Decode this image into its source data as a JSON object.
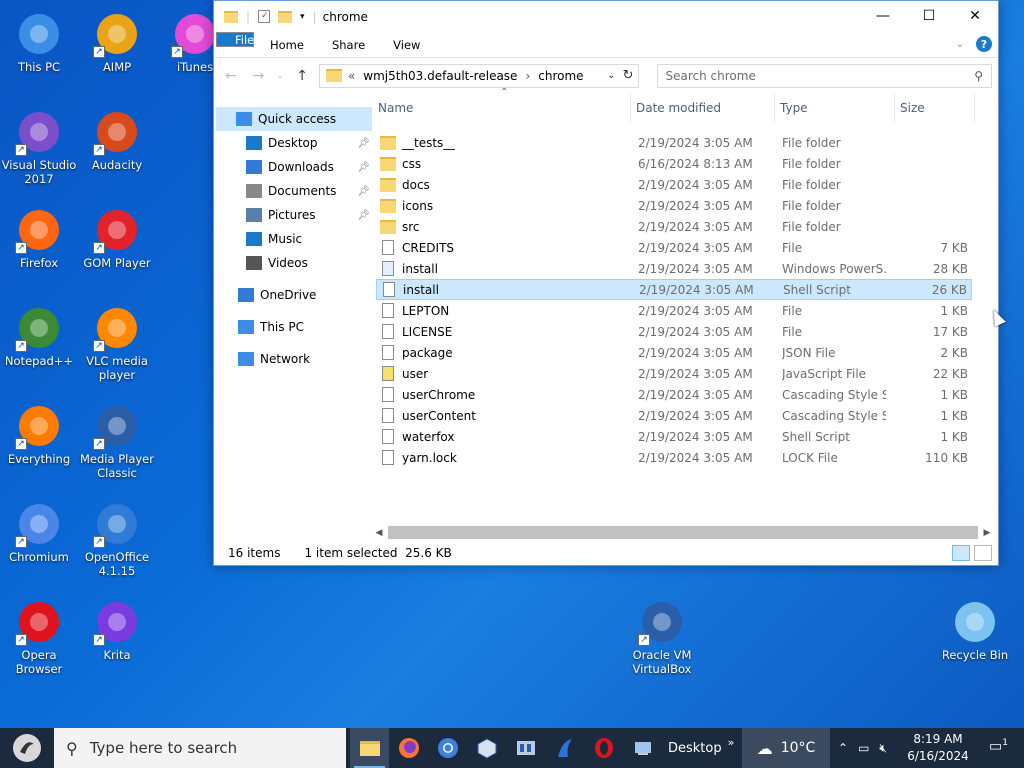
{
  "desktop": {
    "icons": [
      {
        "label": "This PC"
      },
      {
        "label": "AIMP"
      },
      {
        "label": "iTunes"
      },
      {
        "label": "Visual Studio 2017"
      },
      {
        "label": "Audacity"
      },
      {
        "label": "Firefox"
      },
      {
        "label": "GOM Player"
      },
      {
        "label": "Notepad++"
      },
      {
        "label": "VLC media player"
      },
      {
        "label": "Everything"
      },
      {
        "label": "Media Player Classic"
      },
      {
        "label": "Chromium"
      },
      {
        "label": "OpenOffice 4.1.15"
      },
      {
        "label": "Opera Browser"
      },
      {
        "label": "Krita"
      },
      {
        "label": "Oracle VM VirtualBox"
      },
      {
        "label": "Recycle Bin"
      }
    ]
  },
  "window": {
    "title": "chrome",
    "controls": {
      "minimize": "—",
      "maximize": "☐",
      "close": "✕"
    },
    "ribbon": {
      "tabs": [
        "File",
        "Home",
        "Share",
        "View"
      ],
      "help": "?"
    },
    "address": {
      "crumbs": [
        "«",
        "wmj5th03.default-release",
        "›",
        "chrome"
      ]
    },
    "search": {
      "placeholder": "Search chrome"
    },
    "sidebar": [
      {
        "label": "Quick access",
        "kind": "qa"
      },
      {
        "label": "Desktop",
        "kind": "sub",
        "pinned": true
      },
      {
        "label": "Downloads",
        "kind": "sub",
        "pinned": true
      },
      {
        "label": "Documents",
        "kind": "sub",
        "pinned": true
      },
      {
        "label": "Pictures",
        "kind": "sub",
        "pinned": true
      },
      {
        "label": "Music",
        "kind": "sub",
        "pinned": false
      },
      {
        "label": "Videos",
        "kind": "sub",
        "pinned": false
      },
      {
        "label": "OneDrive",
        "kind": "top"
      },
      {
        "label": "This PC",
        "kind": "top"
      },
      {
        "label": "Network",
        "kind": "top"
      }
    ],
    "columns": [
      "Name",
      "Date modified",
      "Type",
      "Size"
    ],
    "files": [
      {
        "name": "__tests__",
        "date": "2/19/2024 3:05 AM",
        "type": "File folder",
        "size": "",
        "icon": "folder"
      },
      {
        "name": "css",
        "date": "6/16/2024 8:13 AM",
        "type": "File folder",
        "size": "",
        "icon": "folder"
      },
      {
        "name": "docs",
        "date": "2/19/2024 3:05 AM",
        "type": "File folder",
        "size": "",
        "icon": "folder"
      },
      {
        "name": "icons",
        "date": "2/19/2024 3:05 AM",
        "type": "File folder",
        "size": "",
        "icon": "folder"
      },
      {
        "name": "src",
        "date": "2/19/2024 3:05 AM",
        "type": "File folder",
        "size": "",
        "icon": "folder"
      },
      {
        "name": "CREDITS",
        "date": "2/19/2024 3:05 AM",
        "type": "File",
        "size": "7 KB",
        "icon": "file"
      },
      {
        "name": "install",
        "date": "2/19/2024 3:05 AM",
        "type": "Windows PowerS...",
        "size": "28 KB",
        "icon": "ps"
      },
      {
        "name": "install",
        "date": "2/19/2024 3:05 AM",
        "type": "Shell Script",
        "size": "26 KB",
        "icon": "sh",
        "selected": true
      },
      {
        "name": "LEPTON",
        "date": "2/19/2024 3:05 AM",
        "type": "File",
        "size": "1 KB",
        "icon": "file"
      },
      {
        "name": "LICENSE",
        "date": "2/19/2024 3:05 AM",
        "type": "File",
        "size": "17 KB",
        "icon": "file"
      },
      {
        "name": "package",
        "date": "2/19/2024 3:05 AM",
        "type": "JSON File",
        "size": "2 KB",
        "icon": "json"
      },
      {
        "name": "user",
        "date": "2/19/2024 3:05 AM",
        "type": "JavaScript File",
        "size": "22 KB",
        "icon": "js"
      },
      {
        "name": "userChrome",
        "date": "2/19/2024 3:05 AM",
        "type": "Cascading Style S...",
        "size": "1 KB",
        "icon": "css"
      },
      {
        "name": "userContent",
        "date": "2/19/2024 3:05 AM",
        "type": "Cascading Style S...",
        "size": "1 KB",
        "icon": "css"
      },
      {
        "name": "waterfox",
        "date": "2/19/2024 3:05 AM",
        "type": "Shell Script",
        "size": "1 KB",
        "icon": "sh"
      },
      {
        "name": "yarn.lock",
        "date": "2/19/2024 3:05 AM",
        "type": "LOCK File",
        "size": "110 KB",
        "icon": "file"
      }
    ],
    "status": {
      "items": "16 items",
      "selected": "1 item selected",
      "size": "25.6 KB"
    }
  },
  "taskbar": {
    "search_placeholder": "Type here to search",
    "desktop_label": "Desktop",
    "desktop_chevron": "»",
    "weather": "10°C",
    "time": "8:19 AM",
    "date": "6/16/2024",
    "notifications": "1"
  },
  "colors": {
    "accent": "#1979ca",
    "selection": "#cce8ff",
    "taskbar": "#1c2a3d"
  }
}
